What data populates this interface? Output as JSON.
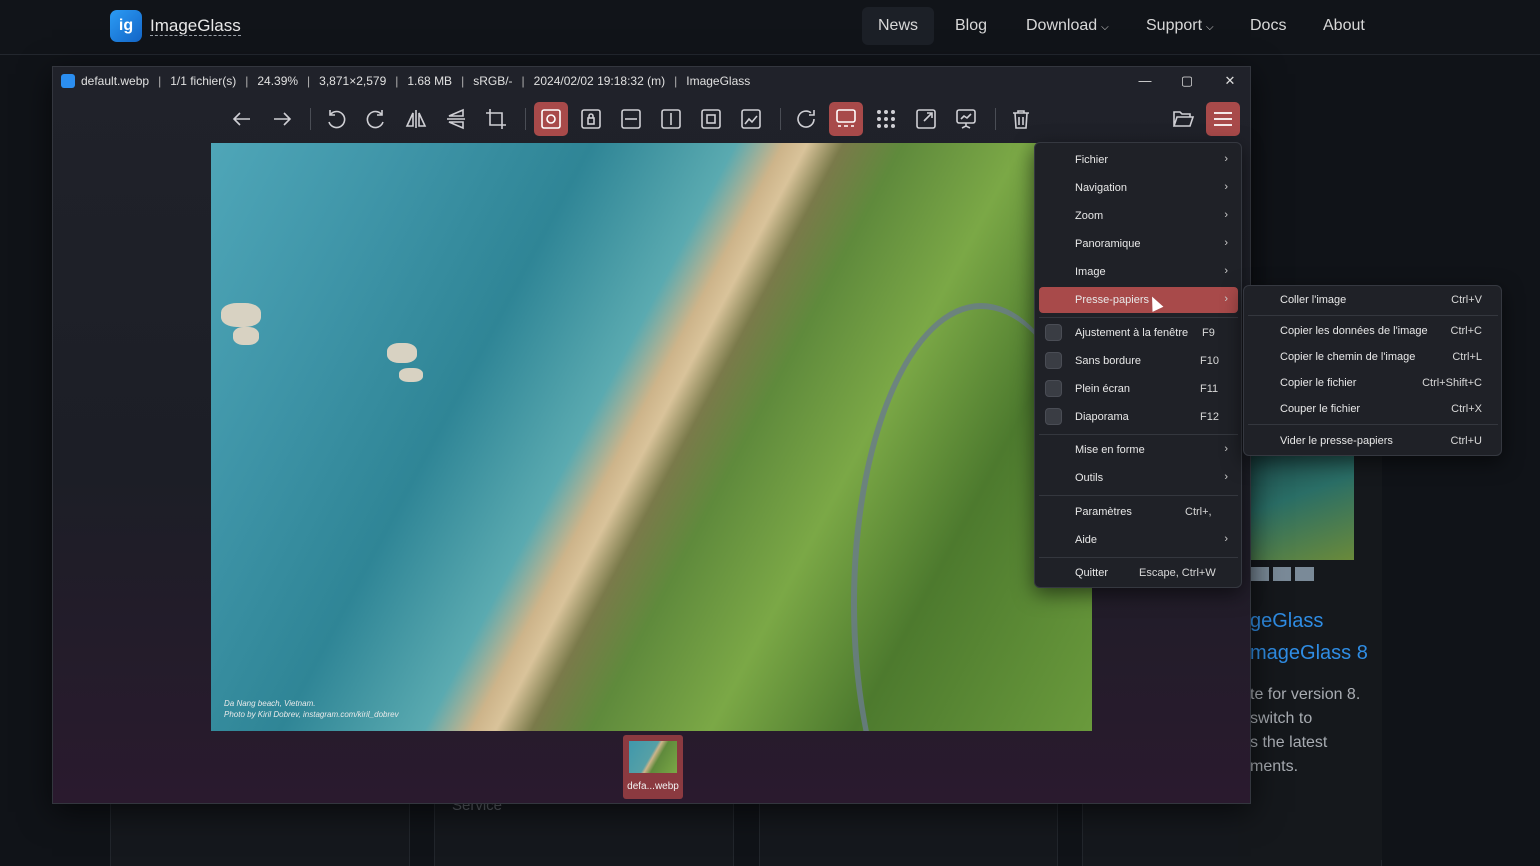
{
  "site": {
    "brand": "ImageGlass",
    "nav": [
      {
        "label": "News"
      },
      {
        "label": "Blog"
      },
      {
        "label": "Download"
      },
      {
        "label": "Support"
      },
      {
        "label": "Docs"
      },
      {
        "label": "About"
      }
    ],
    "background_service_text": "Service",
    "article": {
      "title_line1": "geGlass",
      "title_line2": "mageGlass 8",
      "text_lines": [
        "te for version 8.",
        "switch to",
        "s the latest",
        "ments."
      ]
    }
  },
  "window": {
    "title_items": [
      "default.webp",
      "1/1 fichier(s)",
      "24.39%",
      "3,871×2,579",
      "1.68 MB",
      "sRGB/-",
      "2024/02/02 19:18:32 (m)",
      "ImageGlass"
    ],
    "controls": {
      "minimize": "—",
      "maximize": "▢",
      "close": "✕"
    }
  },
  "photo": {
    "caption_line1": "Da Nang beach, Vietnam.",
    "caption_line2": "Photo by Kiril Dobrev, instagram.com/kiril_dobrev"
  },
  "thumbnail": {
    "label": "defa...webp"
  },
  "menu": {
    "items": [
      {
        "label": "Fichier",
        "submenu": true
      },
      {
        "label": "Navigation",
        "submenu": true
      },
      {
        "label": "Zoom",
        "submenu": true
      },
      {
        "label": "Panoramique",
        "submenu": true
      },
      {
        "label": "Image",
        "submenu": true
      },
      {
        "label": "Presse-papiers",
        "submenu": true,
        "highlighted": true
      },
      {
        "label": "Ajustement à la fenêtre",
        "shortcut": "F9",
        "checkbox": true
      },
      {
        "label": "Sans bordure",
        "shortcut": "F10",
        "checkbox": true
      },
      {
        "label": "Plein écran",
        "shortcut": "F11",
        "checkbox": true
      },
      {
        "label": "Diaporama",
        "shortcut": "F12",
        "checkbox": true
      },
      {
        "label": "Mise en forme",
        "submenu": true
      },
      {
        "label": "Outils",
        "submenu": true
      },
      {
        "label": "Paramètres",
        "shortcut": "Ctrl+,"
      },
      {
        "label": "Aide",
        "submenu": true
      },
      {
        "label": "Quitter",
        "shortcut": "Escape, Ctrl+W"
      }
    ]
  },
  "submenu": {
    "items": [
      {
        "label": "Coller l'image",
        "shortcut": "Ctrl+V"
      },
      {
        "label": "Copier les données de l'image",
        "shortcut": "Ctrl+C"
      },
      {
        "label": "Copier le chemin de l'image",
        "shortcut": "Ctrl+L"
      },
      {
        "label": "Copier le fichier",
        "shortcut": "Ctrl+Shift+C"
      },
      {
        "label": "Couper le fichier",
        "shortcut": "Ctrl+X"
      },
      {
        "label": "Vider le presse-papiers",
        "shortcut": "Ctrl+U"
      }
    ]
  },
  "colors": {
    "accent": "#a84a4a",
    "brand": "#2b8ef0",
    "link": "#2f8de4"
  },
  "icons": [
    "back-arrow-icon",
    "forward-arrow-icon",
    "rotate-left-icon",
    "rotate-right-icon",
    "flip-horizontal-icon",
    "flip-vertical-icon",
    "crop-icon",
    "auto-zoom-icon",
    "lock-zoom-icon",
    "scale-to-width-icon",
    "scale-to-height-icon",
    "scale-to-fit-icon",
    "scale-to-fill-icon",
    "refresh-icon",
    "gallery-icon",
    "checkerboard-icon",
    "fullscreen-icon",
    "slideshow-icon",
    "delete-icon",
    "open-folder-icon",
    "menu-icon"
  ]
}
